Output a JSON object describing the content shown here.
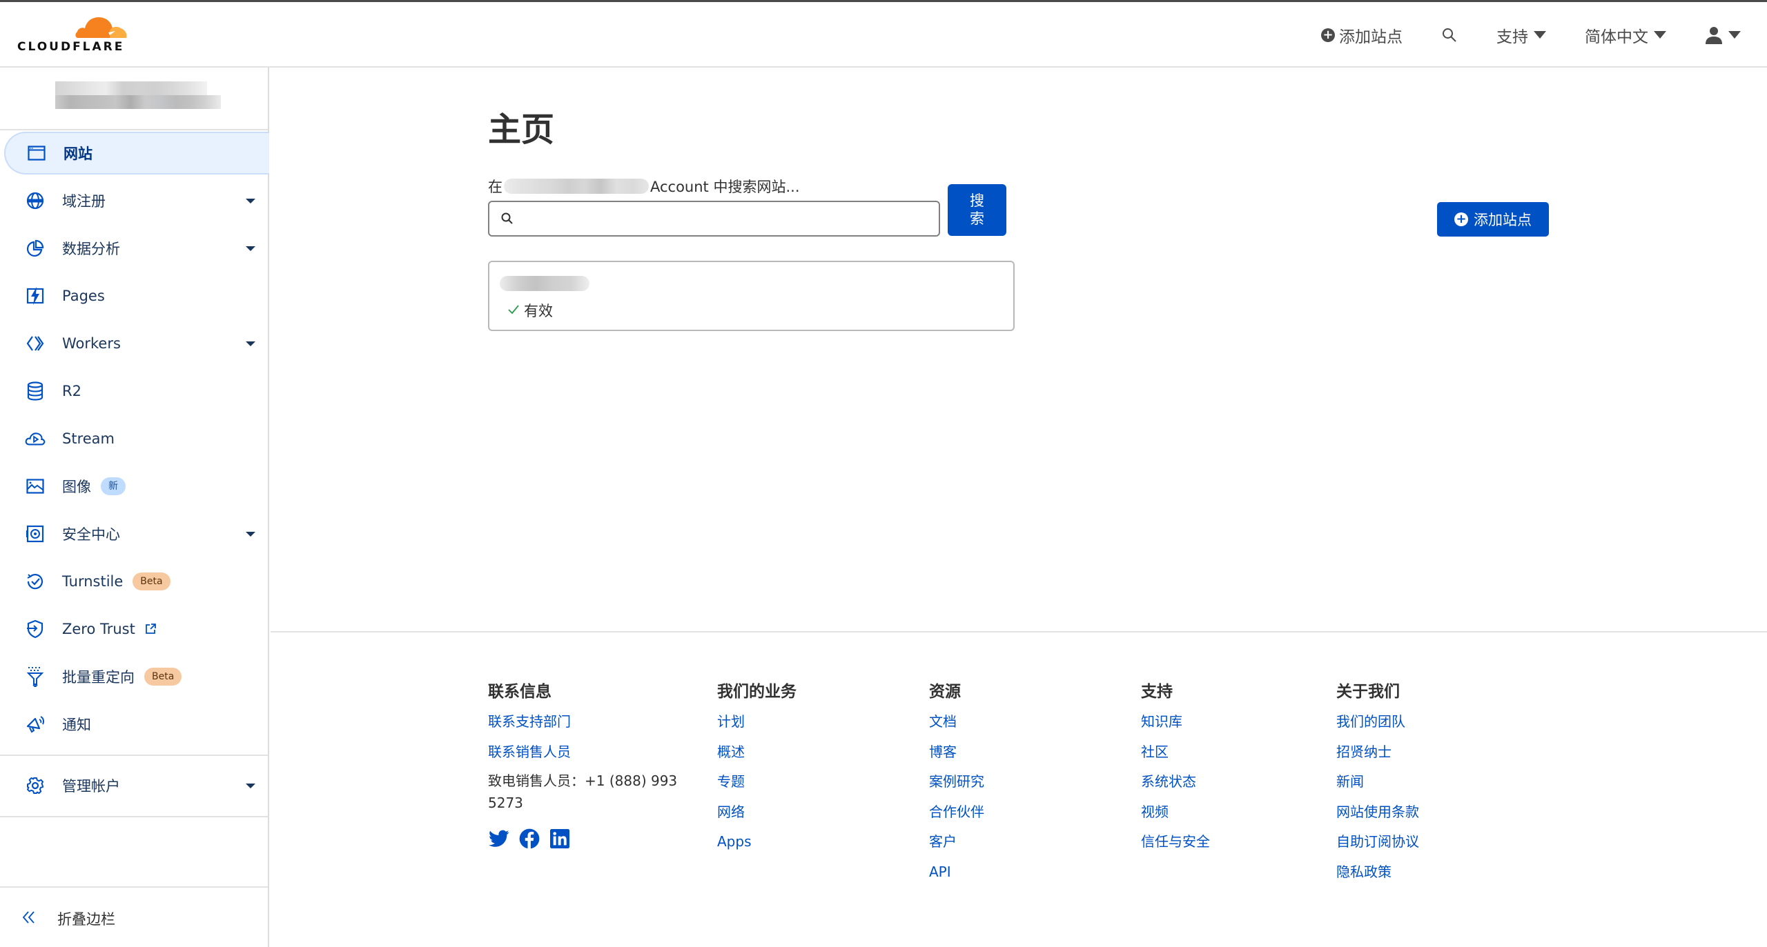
{
  "header": {
    "logo_text": "CLOUDFLARE",
    "add_site_label": "添加站点",
    "support_label": "支持",
    "language_label": "简体中文",
    "icons": {
      "add": "plus-circle-icon",
      "search": "search-icon",
      "user": "user-icon"
    }
  },
  "sidebar": {
    "account_name": "[redacted]",
    "items": [
      {
        "label": "网站",
        "icon": "browser-window-icon",
        "active": true,
        "has_dropdown": false
      },
      {
        "label": "域注册",
        "icon": "globe-www-icon",
        "has_dropdown": true
      },
      {
        "label": "数据分析",
        "icon": "pie-chart-icon",
        "has_dropdown": true
      },
      {
        "label": "Pages",
        "icon": "pages-lightning-icon",
        "has_dropdown": false
      },
      {
        "label": "Workers",
        "icon": "workers-chevrons-icon",
        "has_dropdown": true
      },
      {
        "label": "R2",
        "icon": "database-icon",
        "has_dropdown": false
      },
      {
        "label": "Stream",
        "icon": "cloud-play-icon",
        "has_dropdown": false
      },
      {
        "label": "图像",
        "icon": "image-icon",
        "badge": "新",
        "has_dropdown": false
      },
      {
        "label": "安全中心",
        "icon": "security-vault-icon",
        "has_dropdown": true
      },
      {
        "label": "Turnstile",
        "icon": "turnstile-check-icon",
        "badge": "Beta",
        "has_dropdown": false
      },
      {
        "label": "Zero Trust",
        "icon": "zero-trust-shield-icon",
        "external": true,
        "has_dropdown": false
      },
      {
        "label": "批量重定向",
        "icon": "funnel-redirect-icon",
        "badge": "Beta",
        "has_dropdown": false
      },
      {
        "label": "通知",
        "icon": "megaphone-icon",
        "has_dropdown": false
      }
    ],
    "manage_account": {
      "label": "管理帐户",
      "icon": "gear-icon",
      "has_dropdown": true
    },
    "collapse_label": "折叠边栏"
  },
  "main": {
    "title": "主页",
    "search": {
      "label_prefix": "在",
      "label_account": "[redacted]",
      "label_suffix": "Account 中搜索网站...",
      "value": "",
      "placeholder": "",
      "button_label": "搜索"
    },
    "add_site_button": "添加站点",
    "sites": [
      {
        "domain": "[redacted]",
        "status": "有效"
      }
    ]
  },
  "footer": {
    "columns": [
      {
        "heading": "联系信息",
        "links": [
          "联系支持部门",
          "联系销售人员"
        ],
        "phone_text": "致电销售人员：+1 (888) 993 5273",
        "social": [
          "twitter-icon",
          "facebook-icon",
          "linkedin-icon"
        ]
      },
      {
        "heading": "我们的业务",
        "links": [
          "计划",
          "概述",
          "专题",
          "网络",
          "Apps"
        ]
      },
      {
        "heading": "资源",
        "links": [
          "文档",
          "博客",
          "案例研究",
          "合作伙伴",
          "客户",
          "API"
        ]
      },
      {
        "heading": "支持",
        "links": [
          "知识库",
          "社区",
          "系统状态",
          "视频",
          "信任与安全"
        ]
      },
      {
        "heading": "关于我们",
        "links": [
          "我们的团队",
          "招贤纳士",
          "新闻",
          "网站使用条款",
          "自助订阅协议",
          "隐私政策"
        ]
      }
    ]
  },
  "colors": {
    "brand_orange": "#f6821f",
    "primary_blue": "#0051c3",
    "active_bg": "#e8f1fe",
    "text": "#313131",
    "status_green": "#2c9c4e",
    "beta_badge": "#f7c9a0",
    "new_badge": "#bfdbfe"
  }
}
